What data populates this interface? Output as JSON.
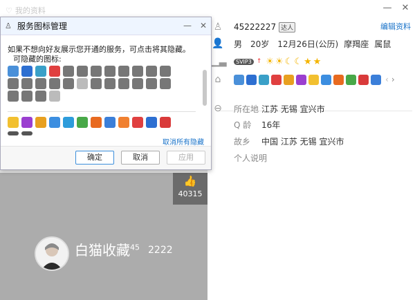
{
  "window": {
    "title": "我的资料"
  },
  "dialog": {
    "title": "服务图标管理",
    "description": "如果不想向好友展示您开通的服务，可点击将其隐藏。",
    "hidden_label": "可隐藏的图标:",
    "cancel_all": "取消所有隐藏",
    "ok": "确定",
    "cancel": "取消",
    "apply": "应用"
  },
  "profile": {
    "qq": "45222227",
    "tag": "达人",
    "edit": "编辑资料",
    "gender": "男",
    "age": "20岁",
    "birthday": "12月26日(公历)",
    "zodiac": "摩羯座",
    "animal": "属鼠",
    "vip": "SVIP3",
    "location_label": "所在地",
    "location": "江苏 无锡 宜兴市",
    "qage_label": "Q 龄",
    "qage": "16年",
    "hometown_label": "故乡",
    "hometown": "中国 江苏 无锡 宜兴市",
    "bio_label": "个人说明"
  },
  "cover": {
    "likes": "40315",
    "nickname": "白猫收藏",
    "nick_sup": "45",
    "nick_id": "2222"
  },
  "colors": {
    "link": "#1a73c9",
    "accent": "#f4b400",
    "cover": "#acacac"
  }
}
